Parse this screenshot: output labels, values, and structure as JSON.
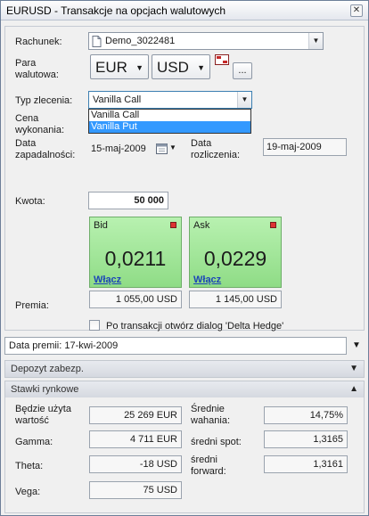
{
  "window": {
    "title": "EURUSD - Transakcje na opcjach walutowych",
    "close_glyph": "✕"
  },
  "account": {
    "label": "Rachunek:",
    "value": "Demo_3022481",
    "icon": "document-icon"
  },
  "currency_pair": {
    "label_line1": "Para",
    "label_line2": "walutowa:",
    "base": "EUR",
    "quote": "USD",
    "more_button": "..."
  },
  "order_type": {
    "label": "Typ zlecenia:",
    "value": "Vanilla Call",
    "options": [
      {
        "label": "Vanilla Call",
        "selected": false
      },
      {
        "label": "Vanilla Put",
        "selected": true
      }
    ]
  },
  "strike": {
    "label_line1": "Cena",
    "label_line2": "wykonania:"
  },
  "expiry": {
    "label_line1": "Data",
    "label_line2": "zapadalności:",
    "value": "15-maj-2009"
  },
  "settlement": {
    "label_line1": "Data",
    "label_line2": "rozliczenia:",
    "value": "19-maj-2009"
  },
  "amount": {
    "label": "Kwota:",
    "value": "50 000"
  },
  "bid": {
    "side": "Bid",
    "price": "0,0211",
    "link": "Włącz",
    "premium": "1 055,00 USD"
  },
  "ask": {
    "side": "Ask",
    "price": "0,0229",
    "link": "Włącz",
    "premium": "1 145,00 USD"
  },
  "premium_label": "Premia:",
  "delta_hedge": {
    "label": "Po transakcji otwórz dialog 'Delta Hedge'",
    "checked": false
  },
  "premium_date": {
    "text": "Data premii: 17-kwi-2009"
  },
  "sections": {
    "deposit": "Depozyt zabezp.",
    "market_rates": "Stawki rynkowe"
  },
  "stats": {
    "used_value_label_line1": "Będzie użyta",
    "used_value_label_line2": "wartość",
    "used_value": "25 269 EUR",
    "gamma_label": "Gamma:",
    "gamma": "4 711 EUR",
    "theta_label": "Theta:",
    "theta": "-18 USD",
    "vega_label": "Vega:",
    "vega": "75 USD",
    "volatility_label_line1": "Średnie",
    "volatility_label_line2": "wahania:",
    "volatility": "14,75%",
    "spot_label": "średni spot:",
    "spot": "1,3165",
    "forward_label_line1": "średni",
    "forward_label_line2": "forward:",
    "forward": "1,3161"
  },
  "colors": {
    "price_box_green": "#9de597",
    "link_blue": "#1b45b7",
    "selection_blue": "#3399ff"
  }
}
